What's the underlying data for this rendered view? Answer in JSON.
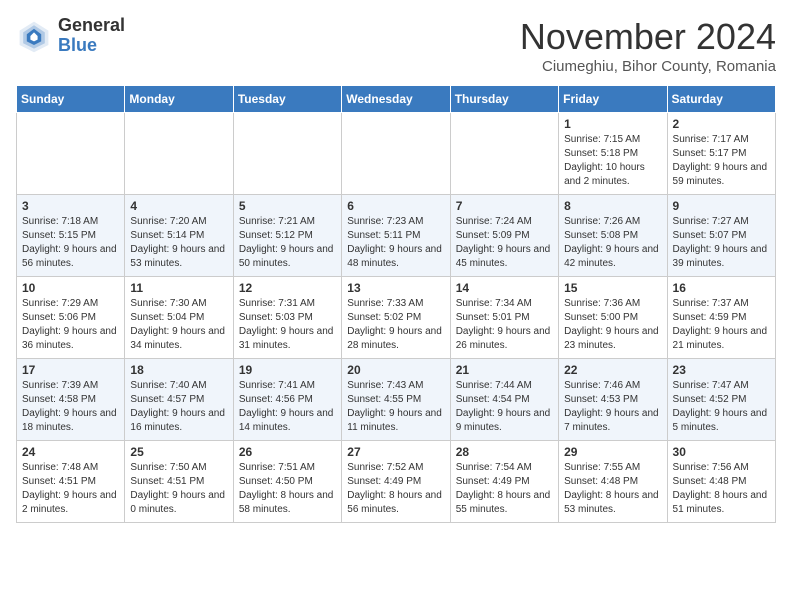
{
  "logo": {
    "general": "General",
    "blue": "Blue"
  },
  "header": {
    "month": "November 2024",
    "location": "Ciumeghiu, Bihor County, Romania"
  },
  "weekdays": [
    "Sunday",
    "Monday",
    "Tuesday",
    "Wednesday",
    "Thursday",
    "Friday",
    "Saturday"
  ],
  "weeks": [
    [
      {
        "day": "",
        "text": ""
      },
      {
        "day": "",
        "text": ""
      },
      {
        "day": "",
        "text": ""
      },
      {
        "day": "",
        "text": ""
      },
      {
        "day": "",
        "text": ""
      },
      {
        "day": "1",
        "text": "Sunrise: 7:15 AM\nSunset: 5:18 PM\nDaylight: 10 hours and 2 minutes."
      },
      {
        "day": "2",
        "text": "Sunrise: 7:17 AM\nSunset: 5:17 PM\nDaylight: 9 hours and 59 minutes."
      }
    ],
    [
      {
        "day": "3",
        "text": "Sunrise: 7:18 AM\nSunset: 5:15 PM\nDaylight: 9 hours and 56 minutes."
      },
      {
        "day": "4",
        "text": "Sunrise: 7:20 AM\nSunset: 5:14 PM\nDaylight: 9 hours and 53 minutes."
      },
      {
        "day": "5",
        "text": "Sunrise: 7:21 AM\nSunset: 5:12 PM\nDaylight: 9 hours and 50 minutes."
      },
      {
        "day": "6",
        "text": "Sunrise: 7:23 AM\nSunset: 5:11 PM\nDaylight: 9 hours and 48 minutes."
      },
      {
        "day": "7",
        "text": "Sunrise: 7:24 AM\nSunset: 5:09 PM\nDaylight: 9 hours and 45 minutes."
      },
      {
        "day": "8",
        "text": "Sunrise: 7:26 AM\nSunset: 5:08 PM\nDaylight: 9 hours and 42 minutes."
      },
      {
        "day": "9",
        "text": "Sunrise: 7:27 AM\nSunset: 5:07 PM\nDaylight: 9 hours and 39 minutes."
      }
    ],
    [
      {
        "day": "10",
        "text": "Sunrise: 7:29 AM\nSunset: 5:06 PM\nDaylight: 9 hours and 36 minutes."
      },
      {
        "day": "11",
        "text": "Sunrise: 7:30 AM\nSunset: 5:04 PM\nDaylight: 9 hours and 34 minutes."
      },
      {
        "day": "12",
        "text": "Sunrise: 7:31 AM\nSunset: 5:03 PM\nDaylight: 9 hours and 31 minutes."
      },
      {
        "day": "13",
        "text": "Sunrise: 7:33 AM\nSunset: 5:02 PM\nDaylight: 9 hours and 28 minutes."
      },
      {
        "day": "14",
        "text": "Sunrise: 7:34 AM\nSunset: 5:01 PM\nDaylight: 9 hours and 26 minutes."
      },
      {
        "day": "15",
        "text": "Sunrise: 7:36 AM\nSunset: 5:00 PM\nDaylight: 9 hours and 23 minutes."
      },
      {
        "day": "16",
        "text": "Sunrise: 7:37 AM\nSunset: 4:59 PM\nDaylight: 9 hours and 21 minutes."
      }
    ],
    [
      {
        "day": "17",
        "text": "Sunrise: 7:39 AM\nSunset: 4:58 PM\nDaylight: 9 hours and 18 minutes."
      },
      {
        "day": "18",
        "text": "Sunrise: 7:40 AM\nSunset: 4:57 PM\nDaylight: 9 hours and 16 minutes."
      },
      {
        "day": "19",
        "text": "Sunrise: 7:41 AM\nSunset: 4:56 PM\nDaylight: 9 hours and 14 minutes."
      },
      {
        "day": "20",
        "text": "Sunrise: 7:43 AM\nSunset: 4:55 PM\nDaylight: 9 hours and 11 minutes."
      },
      {
        "day": "21",
        "text": "Sunrise: 7:44 AM\nSunset: 4:54 PM\nDaylight: 9 hours and 9 minutes."
      },
      {
        "day": "22",
        "text": "Sunrise: 7:46 AM\nSunset: 4:53 PM\nDaylight: 9 hours and 7 minutes."
      },
      {
        "day": "23",
        "text": "Sunrise: 7:47 AM\nSunset: 4:52 PM\nDaylight: 9 hours and 5 minutes."
      }
    ],
    [
      {
        "day": "24",
        "text": "Sunrise: 7:48 AM\nSunset: 4:51 PM\nDaylight: 9 hours and 2 minutes."
      },
      {
        "day": "25",
        "text": "Sunrise: 7:50 AM\nSunset: 4:51 PM\nDaylight: 9 hours and 0 minutes."
      },
      {
        "day": "26",
        "text": "Sunrise: 7:51 AM\nSunset: 4:50 PM\nDaylight: 8 hours and 58 minutes."
      },
      {
        "day": "27",
        "text": "Sunrise: 7:52 AM\nSunset: 4:49 PM\nDaylight: 8 hours and 56 minutes."
      },
      {
        "day": "28",
        "text": "Sunrise: 7:54 AM\nSunset: 4:49 PM\nDaylight: 8 hours and 55 minutes."
      },
      {
        "day": "29",
        "text": "Sunrise: 7:55 AM\nSunset: 4:48 PM\nDaylight: 8 hours and 53 minutes."
      },
      {
        "day": "30",
        "text": "Sunrise: 7:56 AM\nSunset: 4:48 PM\nDaylight: 8 hours and 51 minutes."
      }
    ]
  ]
}
